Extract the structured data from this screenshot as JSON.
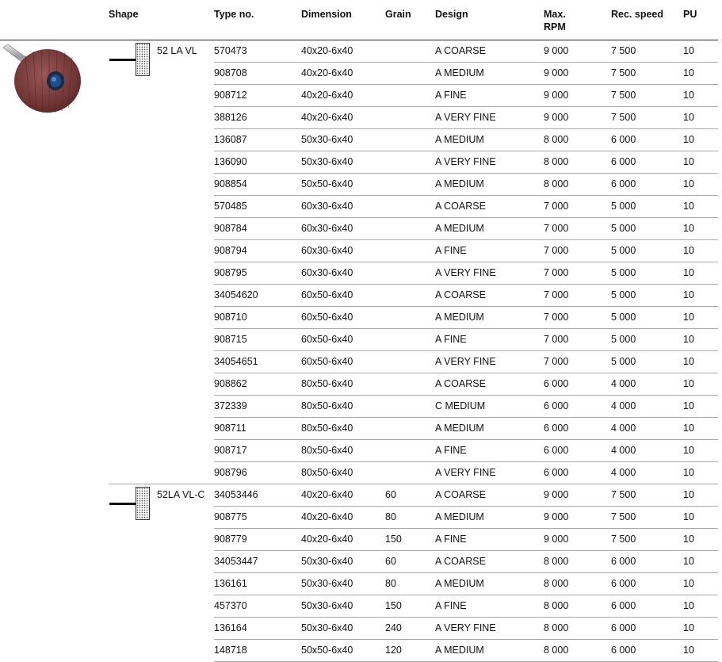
{
  "columns": [
    {
      "key": "shape",
      "label": [
        "Shape"
      ]
    },
    {
      "key": "type_no",
      "label": [
        "Type no."
      ]
    },
    {
      "key": "dimension",
      "label": [
        "Dimension"
      ]
    },
    {
      "key": "grain",
      "label": [
        "Grain"
      ]
    },
    {
      "key": "design",
      "label": [
        "Design"
      ]
    },
    {
      "key": "max_rpm",
      "label": [
        "Max.",
        "RPM"
      ]
    },
    {
      "key": "rec_speed",
      "label": [
        "Rec. speed"
      ]
    },
    {
      "key": "pu",
      "label": [
        "PU"
      ]
    }
  ],
  "groups": [
    {
      "shape_label": "52 LA VL",
      "rows": [
        [
          "570473",
          "40x20-6x40",
          "",
          "A COARSE",
          "9 000",
          "7 500",
          "10"
        ],
        [
          "908708",
          "40x20-6x40",
          "",
          "A MEDIUM",
          "9 000",
          "7 500",
          "10"
        ],
        [
          "908712",
          "40x20-6x40",
          "",
          "A FINE",
          "9 000",
          "7 500",
          "10"
        ],
        [
          "388126",
          "40x20-6x40",
          "",
          "A VERY FINE",
          "9 000",
          "7 500",
          "10"
        ],
        [
          "136087",
          "50x30-6x40",
          "",
          "A MEDIUM",
          "8 000",
          "6 000",
          "10"
        ],
        [
          "136090",
          "50x30-6x40",
          "",
          "A VERY FINE",
          "8 000",
          "6 000",
          "10"
        ],
        [
          "908854",
          "50x50-6x40",
          "",
          "A MEDIUM",
          "8 000",
          "6 000",
          "10"
        ],
        [
          "570485",
          "60x30-6x40",
          "",
          "A COARSE",
          "7 000",
          "5 000",
          "10"
        ],
        [
          "908784",
          "60x30-6x40",
          "",
          "A MEDIUM",
          "7 000",
          "5 000",
          "10"
        ],
        [
          "908794",
          "60x30-6x40",
          "",
          "A FINE",
          "7 000",
          "5 000",
          "10"
        ],
        [
          "908795",
          "60x30-6x40",
          "",
          "A VERY FINE",
          "7 000",
          "5 000",
          "10"
        ],
        [
          "34054620",
          "60x50-6x40",
          "",
          "A COARSE",
          "7 000",
          "5 000",
          "10"
        ],
        [
          "908710",
          "60x50-6x40",
          "",
          "A MEDIUM",
          "7 000",
          "5 000",
          "10"
        ],
        [
          "908715",
          "60x50-6x40",
          "",
          "A FINE",
          "7 000",
          "5 000",
          "10"
        ],
        [
          "34054651",
          "60x50-6x40",
          "",
          "A VERY FINE",
          "7 000",
          "5 000",
          "10"
        ],
        [
          "908862",
          "80x50-6x40",
          "",
          "A COARSE",
          "6 000",
          "4 000",
          "10"
        ],
        [
          "372339",
          "80x50-6x40",
          "",
          "C MEDIUM",
          "6 000",
          "4 000",
          "10"
        ],
        [
          "908711",
          "80x50-6x40",
          "",
          "A MEDIUM",
          "6 000",
          "4 000",
          "10"
        ],
        [
          "908717",
          "80x50-6x40",
          "",
          "A FINE",
          "6 000",
          "4 000",
          "10"
        ],
        [
          "908796",
          "80x50-6x40",
          "",
          "A VERY FINE",
          "6 000",
          "4 000",
          "10"
        ]
      ]
    },
    {
      "shape_label": "52LA VL-C",
      "rows": [
        [
          "34053446",
          "40x20-6x40",
          "60",
          "A COARSE",
          "9 000",
          "7 500",
          "10"
        ],
        [
          "908775",
          "40x20-6x40",
          "80",
          "A MEDIUM",
          "9 000",
          "7 500",
          "10"
        ],
        [
          "908779",
          "40x20-6x40",
          "150",
          "A FINE",
          "9 000",
          "7 500",
          "10"
        ],
        [
          "34053447",
          "50x30-6x40",
          "60",
          "A COARSE",
          "8 000",
          "6 000",
          "10"
        ],
        [
          "136161",
          "50x30-6x40",
          "80",
          "A MEDIUM",
          "8 000",
          "6 000",
          "10"
        ],
        [
          "457370",
          "50x30-6x40",
          "150",
          "A FINE",
          "8 000",
          "6 000",
          "10"
        ],
        [
          "136164",
          "50x30-6x40",
          "240",
          "A VERY FINE",
          "8 000",
          "6 000",
          "10"
        ],
        [
          "148718",
          "50x50-6x40",
          "120",
          "A MEDIUM",
          "8 000",
          "6 000",
          "10"
        ]
      ]
    }
  ],
  "colors": {
    "photo_body": "#7a3d3d",
    "photo_hub": "#1d4f8a",
    "rules": "#a8a8a8"
  },
  "icons": {
    "product_photo": "flap-wheel-image",
    "shape_diagram": "flap-wheel-shape-icon"
  }
}
